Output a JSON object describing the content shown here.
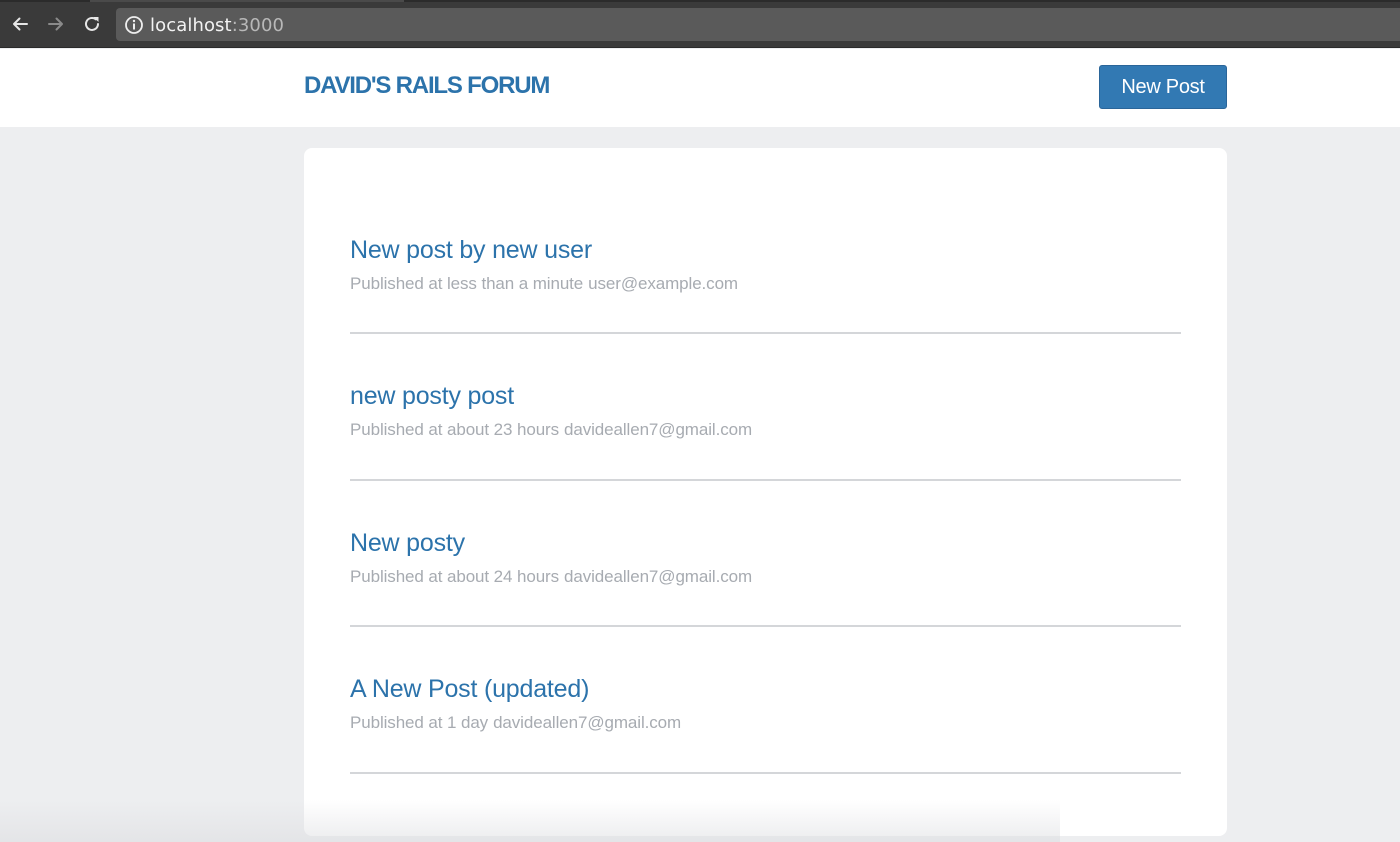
{
  "browser": {
    "url_host": "localhost",
    "url_port": ":3000",
    "back_icon": "arrow-left-icon",
    "forward_icon": "arrow-right-icon",
    "reload_icon": "reload-icon",
    "info_icon": "info-circle-icon"
  },
  "header": {
    "brand": "DAVID'S RAILS FORUM",
    "new_post_label": "New Post"
  },
  "colors": {
    "accent": "#2c73ab",
    "button": "#3279b3",
    "meta_text": "#a7abb1",
    "page_bg": "#edeef0"
  },
  "posts": [
    {
      "title": "New post by new user",
      "published": "Published at less than a minute",
      "author": "user@example.com"
    },
    {
      "title": "new posty post",
      "published": "Published at about 23 hours",
      "author": "davideallen7@gmail.com"
    },
    {
      "title": "New posty",
      "published": "Published at about 24 hours",
      "author": "davideallen7@gmail.com"
    },
    {
      "title": "A New Post (updated)",
      "published": "Published at 1 day",
      "author": "davideallen7@gmail.com"
    }
  ]
}
